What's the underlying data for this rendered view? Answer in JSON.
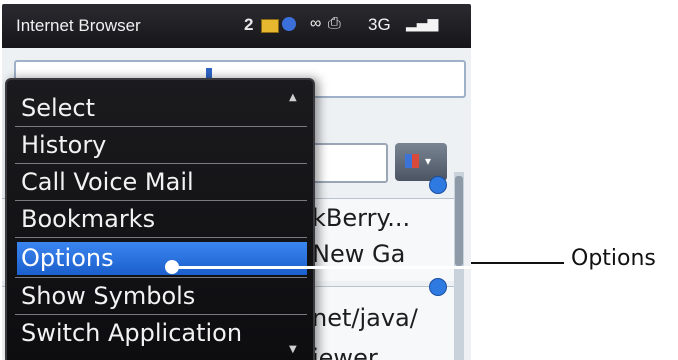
{
  "statusbar": {
    "app_title": "Internet Browser",
    "notification_count": "2",
    "icons_text": "∞ ⎙",
    "network": "3G",
    "signal_icon": "signal-bars-icon"
  },
  "browser": {
    "content_lines": [
      "kBerry...",
      "New Ga",
      "net/java/",
      "iewer..."
    ]
  },
  "menu": {
    "items": [
      {
        "label": "Select"
      },
      {
        "label": "History"
      },
      {
        "label": "Call Voice Mail"
      },
      {
        "label": "Bookmarks"
      },
      {
        "label": "Options"
      },
      {
        "label": "Show Symbols"
      },
      {
        "label": "Switch Application"
      }
    ],
    "selected_index": 4
  },
  "callout": {
    "label": "Options"
  },
  "colors": {
    "menu_bg": "#111114",
    "selection": "#2a72e0",
    "menu_text": "#f2f2f2"
  }
}
